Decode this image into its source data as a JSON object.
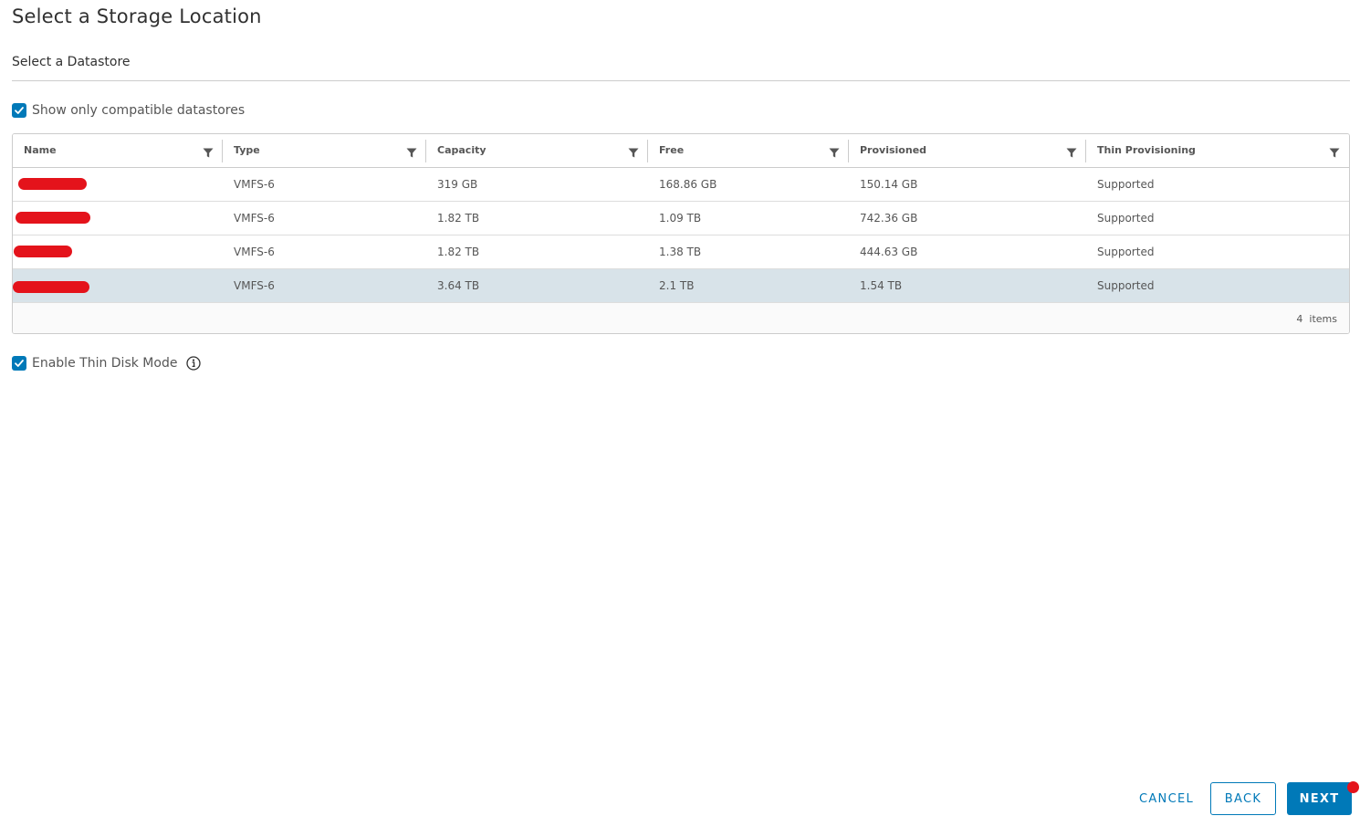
{
  "page": {
    "title": "Select a Storage Location",
    "subtitle": "Select a Datastore"
  },
  "options": {
    "compatible_label": "Show only compatible datastores",
    "compatible_checked": true,
    "thin_disk_label": "Enable Thin Disk Mode",
    "thin_disk_checked": true
  },
  "grid": {
    "columns": [
      "Name",
      "Type",
      "Capacity",
      "Free",
      "Provisioned",
      "Thin Provisioning"
    ],
    "rows": [
      {
        "name": "",
        "type": "VMFS-6",
        "capacity": "319 GB",
        "free": "168.86 GB",
        "provisioned": "150.14 GB",
        "thin": "Supported",
        "selected": false
      },
      {
        "name": "",
        "type": "VMFS-6",
        "capacity": "1.82 TB",
        "free": "1.09 TB",
        "provisioned": "742.36 GB",
        "thin": "Supported",
        "selected": false
      },
      {
        "name": "",
        "type": "VMFS-6",
        "capacity": "1.82 TB",
        "free": "1.38 TB",
        "provisioned": "444.63 GB",
        "thin": "Supported",
        "selected": false
      },
      {
        "name": "",
        "type": "VMFS-6",
        "capacity": "3.64 TB",
        "free": "2.1 TB",
        "provisioned": "1.54 TB",
        "thin": "Supported",
        "selected": true
      }
    ],
    "footer": "4  items"
  },
  "buttons": {
    "cancel": "CANCEL",
    "back": "BACK",
    "next": "NEXT"
  },
  "colors": {
    "accent": "#0079b8",
    "selected_row": "#d8e3e9",
    "redaction": "#e4131b"
  },
  "icons": [
    "checkbox-checked-icon",
    "filter-icon",
    "info-icon"
  ]
}
